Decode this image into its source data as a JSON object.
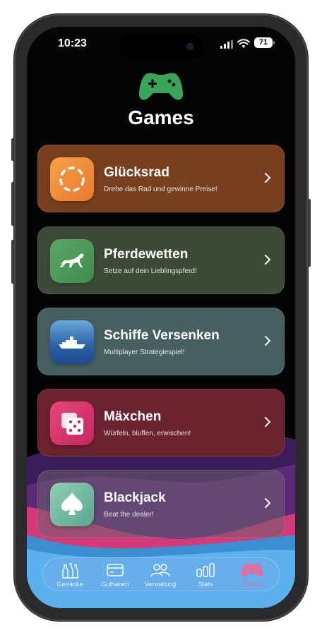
{
  "status_bar": {
    "time": "10:23",
    "battery": "71"
  },
  "header": {
    "title": "Games",
    "icon": "gamepad-icon"
  },
  "games": [
    {
      "title": "Glücksrad",
      "subtitle": "Drehe das Rad und gewinne Preise!",
      "icon": "wheel-icon",
      "color": "#78401f"
    },
    {
      "title": "Pferdewetten",
      "subtitle": "Setze auf dein Lieblingspferd!",
      "icon": "horse-icon",
      "color": "#3d4a38"
    },
    {
      "title": "Schiffe Versenken",
      "subtitle": "Multiplayer Strategiespiel!",
      "icon": "ship-icon",
      "color": "#46605f"
    },
    {
      "title": "Mäxchen",
      "subtitle": "Würfeln, bluffen, erwischen!",
      "icon": "dice-icon",
      "color": "#6c2330"
    },
    {
      "title": "Blackjack",
      "subtitle": "Beat the dealer!",
      "icon": "spade-icon",
      "color": "#6e5f6e"
    }
  ],
  "tabbar": {
    "items": [
      {
        "label": "Getränke",
        "icon": "bottles-icon"
      },
      {
        "label": "Guthaben",
        "icon": "card-icon"
      },
      {
        "label": "Verwaltung",
        "icon": "people-icon"
      },
      {
        "label": "Stats",
        "icon": "bars-icon"
      },
      {
        "label": "Games",
        "icon": "gamepad-icon"
      }
    ],
    "active": "Games",
    "accent": "#e86aa0"
  }
}
